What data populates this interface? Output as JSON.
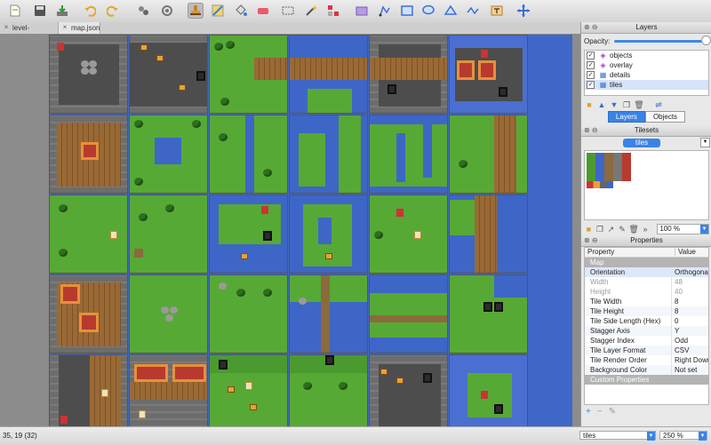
{
  "toolbar": {
    "items": [
      "new-icon",
      "save-icon",
      "export-icon",
      "undo-icon",
      "redo-icon",
      "random-mode-icon",
      "wang-fill-icon",
      "stamp-brush-icon",
      "terrain-brush-icon",
      "bucket-fill-icon",
      "eraser-icon",
      "rect-select-icon",
      "magic-wand-icon",
      "select-same-tile-icon",
      "insert-tile-icon",
      "edit-polygon-icon",
      "insert-rect-icon",
      "insert-ellipse-icon",
      "insert-polygon-icon",
      "insert-polyline-icon",
      "insert-text-icon",
      "select-objects-icon"
    ]
  },
  "tabs": [
    {
      "label": "level-test.tmx"
    },
    {
      "label": "map.json"
    }
  ],
  "layers_panel": {
    "title": "Layers",
    "opacity_label": "Opacity:",
    "layers": [
      {
        "name": "objects",
        "icon": "object-layer-icon"
      },
      {
        "name": "overlay",
        "icon": "object-layer-icon"
      },
      {
        "name": "details",
        "icon": "tile-layer-icon"
      },
      {
        "name": "tiles",
        "icon": "tile-layer-icon"
      }
    ],
    "tabs": [
      "Layers",
      "Objects"
    ]
  },
  "tilesets_panel": {
    "title": "Tilesets",
    "active_tab": "tiles",
    "zoom": "100 %"
  },
  "properties_panel": {
    "title": "Properties",
    "col_property": "Property",
    "col_value": "Value",
    "rows": [
      {
        "name": "Map",
        "value": "",
        "kind": "group"
      },
      {
        "name": "Orientation",
        "value": "Orthogonal",
        "kind": "sel"
      },
      {
        "name": "Width",
        "value": "48",
        "kind": "dis"
      },
      {
        "name": "Height",
        "value": "40",
        "kind": "dis"
      },
      {
        "name": "Tile Width",
        "value": "8",
        "kind": "normal"
      },
      {
        "name": "Tile Height",
        "value": "8",
        "kind": "alt"
      },
      {
        "name": "Tile Side Length (Hex)",
        "value": "0",
        "kind": "normal"
      },
      {
        "name": "Stagger Axis",
        "value": "Y",
        "kind": "alt"
      },
      {
        "name": "Stagger Index",
        "value": "Odd",
        "kind": "normal"
      },
      {
        "name": "Tile Layer Format",
        "value": "CSV",
        "kind": "alt"
      },
      {
        "name": "Tile Render Order",
        "value": "Right Down",
        "kind": "normal"
      },
      {
        "name": "Background Color",
        "value": "Not set",
        "kind": "alt"
      },
      {
        "name": "Custom Properties",
        "value": "",
        "kind": "group"
      }
    ]
  },
  "status": {
    "coords": "35, 19 (32)",
    "layer": "tiles",
    "zoom": "250 %"
  }
}
